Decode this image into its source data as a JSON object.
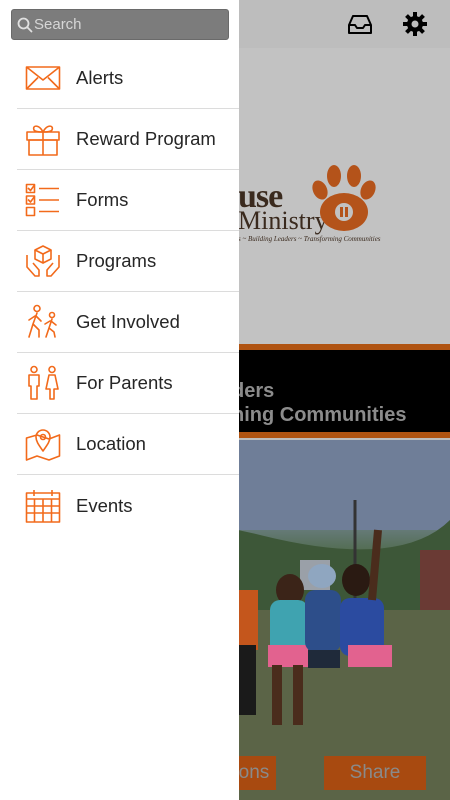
{
  "search": {
    "placeholder": "Search"
  },
  "menu": {
    "items": [
      {
        "label": "Alerts",
        "icon": "envelope-icon"
      },
      {
        "label": "Reward Program",
        "icon": "gift-icon"
      },
      {
        "label": "Forms",
        "icon": "checklist-icon"
      },
      {
        "label": "Programs",
        "icon": "hands-box-icon"
      },
      {
        "label": "Get Involved",
        "icon": "walking-people-icon"
      },
      {
        "label": "For Parents",
        "icon": "parents-icon"
      },
      {
        "label": "Location",
        "icon": "map-pin-icon"
      },
      {
        "label": "Events",
        "icon": "calendar-icon"
      }
    ]
  },
  "background": {
    "logo_word": "use",
    "logo_word2": "Ministry",
    "logo_tagline": "s ~ Building Leaders ~ Transforming Communities",
    "banner_line1": "ders",
    "banner_line2": "ning Communities",
    "buttons": [
      "ons",
      "Share"
    ]
  },
  "colors": {
    "accent": "#f26a1b",
    "drawer_bg": "#ffffff",
    "search_bg": "#7c7c7c",
    "banner_bg": "#000000"
  }
}
